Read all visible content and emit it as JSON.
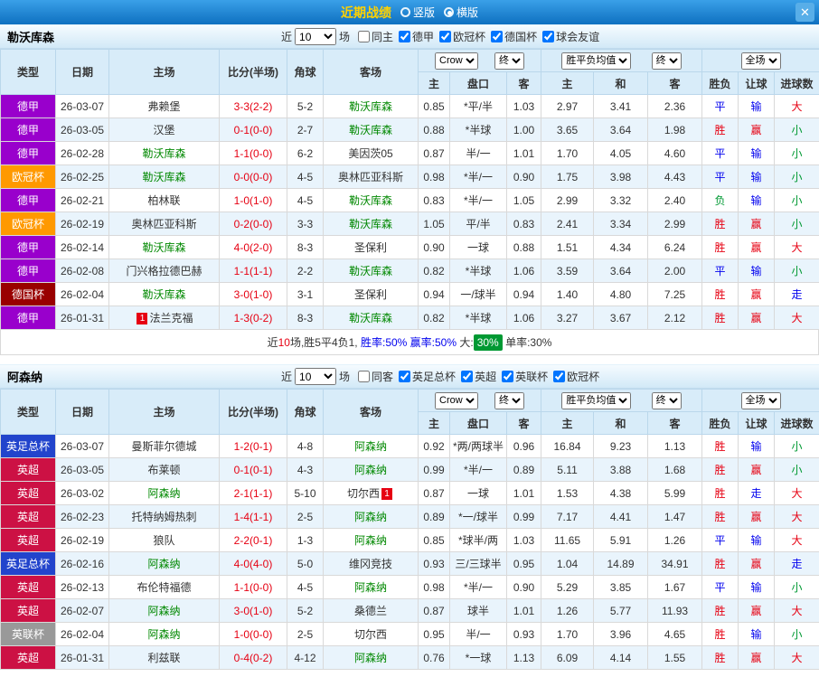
{
  "titlebar": {
    "title": "近期战绩",
    "layout_options": [
      {
        "label": "竖版",
        "selected": false
      },
      {
        "label": "横版",
        "selected": true
      }
    ],
    "close_label": "✕"
  },
  "headers": {
    "type": "类型",
    "date": "日期",
    "home": "主场",
    "score": "比分(半场)",
    "corner": "角球",
    "away": "客场",
    "odds_source": "Crow",
    "final_label": "终",
    "euro_avg": "胜平负均值",
    "scope": "全场",
    "sub_home": "主",
    "sub_handicap": "盘口",
    "sub_away": "客",
    "sub_draw": "和",
    "result": "胜负",
    "handicap": "让球",
    "goals": "进球数"
  },
  "type_colors": {
    "德甲": "#9900cc",
    "欧冠杯": "#ff9900",
    "德国杯": "#990000",
    "英足总杯": "#2244cc",
    "英超": "#cc1144",
    "英联杯": "#999999"
  },
  "value_colors": {
    "胜": "#e60012",
    "平": "#0000ee",
    "负": "#009933",
    "赢": "#e60012",
    "输": "#0000ee",
    "走": "#0000ee",
    "大": "#e60012",
    "小": "#009933"
  },
  "sections": [
    {
      "team": "勒沃库森",
      "filter": {
        "near_label": "近",
        "count": "10",
        "unit_label": "场",
        "same_label": "同主",
        "same_checked": false,
        "leagues": [
          {
            "label": "德甲",
            "checked": true
          },
          {
            "label": "欧冠杯",
            "checked": true
          },
          {
            "label": "德国杯",
            "checked": true
          },
          {
            "label": "球会友谊",
            "checked": true
          }
        ]
      },
      "rows": [
        {
          "type": "德甲",
          "date": "26-03-07",
          "home": "弗赖堡",
          "score": "3-3(2-2)",
          "corner": "5-2",
          "away": "勒沃库森",
          "odds": [
            "0.85",
            "*平/半",
            "1.03"
          ],
          "euro": [
            "2.97",
            "3.41",
            "2.36"
          ],
          "spf": "平",
          "rq": "输",
          "jq": "大"
        },
        {
          "type": "德甲",
          "date": "26-03-05",
          "home": "汉堡",
          "score": "0-1(0-0)",
          "corner": "2-7",
          "away": "勒沃库森",
          "odds": [
            "0.88",
            "*半球",
            "1.00"
          ],
          "euro": [
            "3.65",
            "3.64",
            "1.98"
          ],
          "spf": "胜",
          "rq": "赢",
          "jq": "小"
        },
        {
          "type": "德甲",
          "date": "26-02-28",
          "home": "勒沃库森",
          "score": "1-1(0-0)",
          "corner": "6-2",
          "away": "美因茨05",
          "odds": [
            "0.87",
            "半/一",
            "1.01"
          ],
          "euro": [
            "1.70",
            "4.05",
            "4.60"
          ],
          "spf": "平",
          "rq": "输",
          "jq": "小"
        },
        {
          "type": "欧冠杯",
          "date": "26-02-25",
          "home": "勒沃库森",
          "score": "0-0(0-0)",
          "corner": "4-5",
          "away": "奥林匹亚科斯",
          "odds": [
            "0.98",
            "*半/一",
            "0.90"
          ],
          "euro": [
            "1.75",
            "3.98",
            "4.43"
          ],
          "spf": "平",
          "rq": "输",
          "jq": "小"
        },
        {
          "type": "德甲",
          "date": "26-02-21",
          "home": "柏林联",
          "score": "1-0(1-0)",
          "corner": "4-5",
          "away": "勒沃库森",
          "odds": [
            "0.83",
            "*半/一",
            "1.05"
          ],
          "euro": [
            "2.99",
            "3.32",
            "2.40"
          ],
          "spf": "负",
          "rq": "输",
          "jq": "小"
        },
        {
          "type": "欧冠杯",
          "date": "26-02-19",
          "home": "奥林匹亚科斯",
          "score": "0-2(0-0)",
          "corner": "3-3",
          "away": "勒沃库森",
          "odds": [
            "1.05",
            "平/半",
            "0.83"
          ],
          "euro": [
            "2.41",
            "3.34",
            "2.99"
          ],
          "spf": "胜",
          "rq": "赢",
          "jq": "小"
        },
        {
          "type": "德甲",
          "date": "26-02-14",
          "home": "勒沃库森",
          "score": "4-0(2-0)",
          "corner": "8-3",
          "away": "圣保利",
          "odds": [
            "0.90",
            "一球",
            "0.88"
          ],
          "euro": [
            "1.51",
            "4.34",
            "6.24"
          ],
          "spf": "胜",
          "rq": "赢",
          "jq": "大"
        },
        {
          "type": "德甲",
          "date": "26-02-08",
          "home": "门兴格拉德巴赫",
          "score": "1-1(1-1)",
          "corner": "2-2",
          "away": "勒沃库森",
          "odds": [
            "0.82",
            "*半球",
            "1.06"
          ],
          "euro": [
            "3.59",
            "3.64",
            "2.00"
          ],
          "spf": "平",
          "rq": "输",
          "jq": "小"
        },
        {
          "type": "德国杯",
          "date": "26-02-04",
          "home": "勒沃库森",
          "score": "3-0(1-0)",
          "corner": "3-1",
          "away": "圣保利",
          "odds": [
            "0.94",
            "一/球半",
            "0.94"
          ],
          "euro": [
            "1.40",
            "4.80",
            "7.25"
          ],
          "spf": "胜",
          "rq": "赢",
          "jq": "走"
        },
        {
          "type": "德甲",
          "date": "26-01-31",
          "home": "法兰克福",
          "home_badge": "1",
          "score": "1-3(0-2)",
          "corner": "8-3",
          "away": "勒沃库森",
          "odds": [
            "0.82",
            "*半球",
            "1.06"
          ],
          "euro": [
            "3.27",
            "3.67",
            "2.12"
          ],
          "spf": "胜",
          "rq": "赢",
          "jq": "大"
        }
      ],
      "summary": {
        "segments": [
          {
            "text": "近",
            "color": "#333333"
          },
          {
            "text": "10",
            "color": "#e60012"
          },
          {
            "text": "场,胜5平4负1, ",
            "color": "#333333"
          },
          {
            "text": "胜率:50%",
            "color": "#0000ee"
          },
          {
            "text": " 赢率:50%",
            "color": "#0000ee"
          },
          {
            "text": " 大:",
            "color": "#333333"
          },
          {
            "text": "30%",
            "color": "#ffffff",
            "bg": "#009933"
          },
          {
            "text": " 单率:30%",
            "color": "#333333"
          }
        ]
      }
    },
    {
      "team": "阿森纳",
      "filter": {
        "near_label": "近",
        "count": "10",
        "unit_label": "场",
        "same_label": "同客",
        "same_checked": false,
        "leagues": [
          {
            "label": "英足总杯",
            "checked": true
          },
          {
            "label": "英超",
            "checked": true
          },
          {
            "label": "英联杯",
            "checked": true
          },
          {
            "label": "欧冠杯",
            "checked": true
          }
        ]
      },
      "rows": [
        {
          "type": "英足总杯",
          "date": "26-03-07",
          "home": "曼斯菲尔德城",
          "score": "1-2(0-1)",
          "corner": "4-8",
          "away": "阿森纳",
          "odds": [
            "0.92",
            "*两/两球半",
            "0.96"
          ],
          "euro": [
            "16.84",
            "9.23",
            "1.13"
          ],
          "spf": "胜",
          "rq": "输",
          "jq": "小"
        },
        {
          "type": "英超",
          "date": "26-03-05",
          "home": "布莱顿",
          "score": "0-1(0-1)",
          "corner": "4-3",
          "away": "阿森纳",
          "odds": [
            "0.99",
            "*半/一",
            "0.89"
          ],
          "euro": [
            "5.11",
            "3.88",
            "1.68"
          ],
          "spf": "胜",
          "rq": "赢",
          "jq": "小"
        },
        {
          "type": "英超",
          "date": "26-03-02",
          "home": "阿森纳",
          "score": "2-1(1-1)",
          "corner": "5-10",
          "away": "切尔西",
          "away_badge": "1",
          "odds": [
            "0.87",
            "一球",
            "1.01"
          ],
          "euro": [
            "1.53",
            "4.38",
            "5.99"
          ],
          "spf": "胜",
          "rq": "走",
          "jq": "大"
        },
        {
          "type": "英超",
          "date": "26-02-23",
          "home": "托特纳姆热刺",
          "score": "1-4(1-1)",
          "corner": "2-5",
          "away": "阿森纳",
          "odds": [
            "0.89",
            "*一/球半",
            "0.99"
          ],
          "euro": [
            "7.17",
            "4.41",
            "1.47"
          ],
          "spf": "胜",
          "rq": "赢",
          "jq": "大"
        },
        {
          "type": "英超",
          "date": "26-02-19",
          "home": "狼队",
          "score": "2-2(0-1)",
          "corner": "1-3",
          "away": "阿森纳",
          "odds": [
            "0.85",
            "*球半/两",
            "1.03"
          ],
          "euro": [
            "11.65",
            "5.91",
            "1.26"
          ],
          "spf": "平",
          "rq": "输",
          "jq": "大"
        },
        {
          "type": "英足总杯",
          "date": "26-02-16",
          "home": "阿森纳",
          "score": "4-0(4-0)",
          "corner": "5-0",
          "away": "维冈竞技",
          "odds": [
            "0.93",
            "三/三球半",
            "0.95"
          ],
          "euro": [
            "1.04",
            "14.89",
            "34.91"
          ],
          "spf": "胜",
          "rq": "赢",
          "jq": "走"
        },
        {
          "type": "英超",
          "date": "26-02-13",
          "home": "布伦特福德",
          "score": "1-1(0-0)",
          "corner": "4-5",
          "away": "阿森纳",
          "odds": [
            "0.98",
            "*半/一",
            "0.90"
          ],
          "euro": [
            "5.29",
            "3.85",
            "1.67"
          ],
          "spf": "平",
          "rq": "输",
          "jq": "小"
        },
        {
          "type": "英超",
          "date": "26-02-07",
          "home": "阿森纳",
          "score": "3-0(1-0)",
          "corner": "5-2",
          "away": "桑德兰",
          "odds": [
            "0.87",
            "球半",
            "1.01"
          ],
          "euro": [
            "1.26",
            "5.77",
            "11.93"
          ],
          "spf": "胜",
          "rq": "赢",
          "jq": "大"
        },
        {
          "type": "英联杯",
          "date": "26-02-04",
          "home": "阿森纳",
          "score": "1-0(0-0)",
          "corner": "2-5",
          "away": "切尔西",
          "odds": [
            "0.95",
            "半/一",
            "0.93"
          ],
          "euro": [
            "1.70",
            "3.96",
            "4.65"
          ],
          "spf": "胜",
          "rq": "输",
          "jq": "小"
        },
        {
          "type": "英超",
          "date": "26-01-31",
          "home": "利兹联",
          "score": "0-4(0-2)",
          "corner": "4-12",
          "away": "阿森纳",
          "odds": [
            "0.76",
            "*一球",
            "1.13"
          ],
          "euro": [
            "6.09",
            "4.14",
            "1.55"
          ],
          "spf": "胜",
          "rq": "赢",
          "jq": "大"
        }
      ]
    }
  ]
}
